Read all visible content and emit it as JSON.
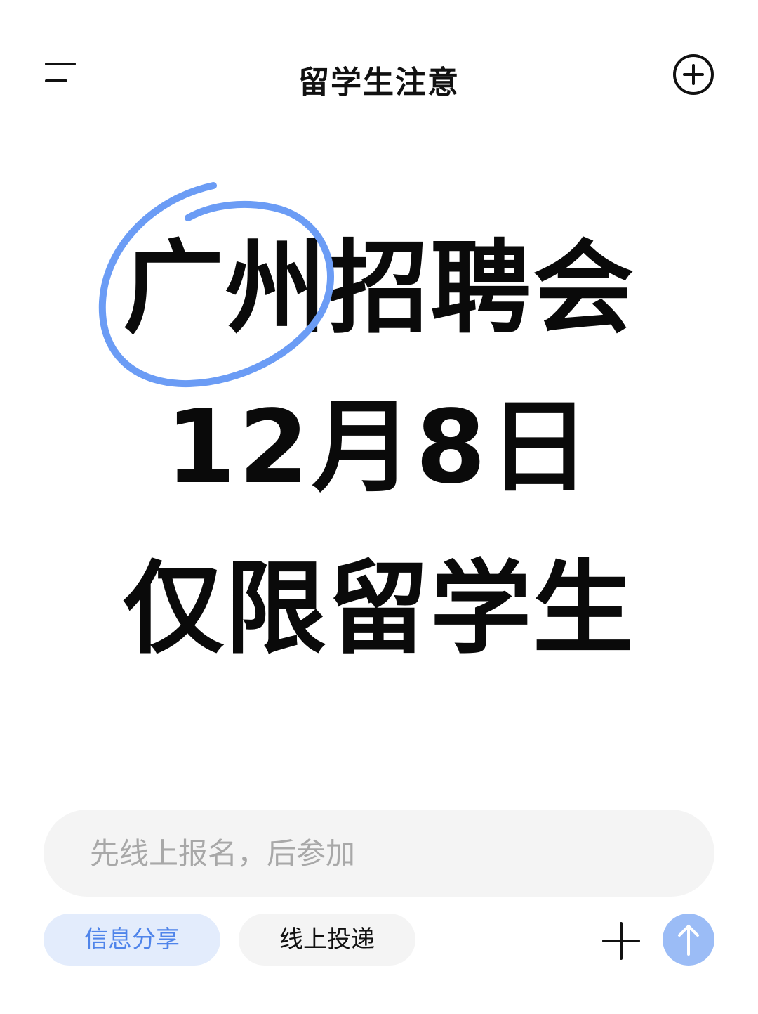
{
  "header": {
    "title": "留学生注意",
    "menu_icon": "menu-icon",
    "add_icon": "add-circle-icon"
  },
  "headline": {
    "line1": "广州招聘会",
    "line2": "12月8日",
    "line3": "仅限留学生",
    "highlight_color": "#6b9cf5"
  },
  "composer": {
    "value": "",
    "placeholder": "先线上报名，后参加"
  },
  "chips": [
    {
      "label": "信息分享",
      "active": true
    },
    {
      "label": "线上投递",
      "active": false
    }
  ],
  "actions": {
    "plus_icon": "plus-icon",
    "send_icon": "arrow-up-icon",
    "send_color": "#9bbcf6"
  }
}
